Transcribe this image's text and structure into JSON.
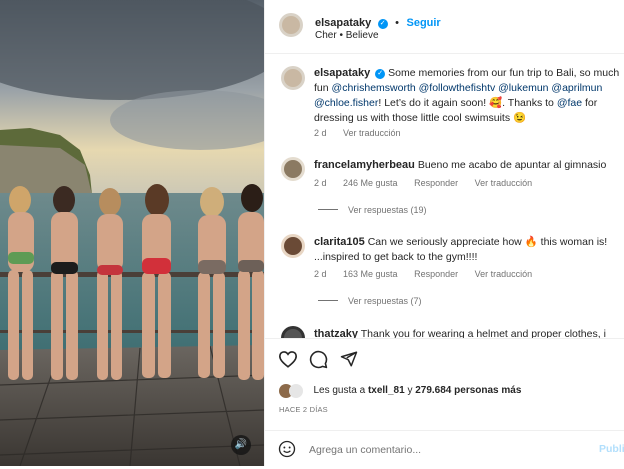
{
  "header": {
    "username": "elsapataky",
    "follow_label": "Seguir",
    "audio": "Cher • Believe"
  },
  "caption": {
    "username": "elsapataky",
    "text_1": "Some memories from our fun trip to Bali, so much fun",
    "mentions_1": "@chrishemsworth @followthefishtv @lukemun @aprilmun",
    "mention_2": "@chloe.fisher",
    "text_2": "! Let’s do it again soon! 🥰. Thanks to",
    "mention_3": "@fae",
    "text_3": "for dressing us with those little cool swimsuits 😉",
    "time": "2 d",
    "translate": "Ver traducción"
  },
  "comments": [
    {
      "username": "francelamyherbeau",
      "text": "Bueno me acabo de apuntar al gimnasio",
      "time": "2 d",
      "likes": "246 Me gusta",
      "reply": "Responder",
      "translate": "Ver traducción",
      "replies": "Ver respuestas (19)"
    },
    {
      "username": "clarita105",
      "text_1": "Can we seriously appreciate how 🔥 this woman is!",
      "text_2": "...inspired to get back to the gym!!!!",
      "time": "2 d",
      "likes": "163 Me gusta",
      "reply": "Responder",
      "translate": "Ver traducción",
      "replies": "Ver respuestas (7)"
    },
    {
      "username": "thatzaky",
      "text": "Thank you for wearing a helmet and proper clothes, i"
    }
  ],
  "likes": {
    "prefix": "Les gusta a",
    "user": "txell_81",
    "middle": "y",
    "count": "279.684 personas más"
  },
  "date": "HACE 2 DÍAS",
  "add_comment": {
    "placeholder": "Agrega un comentario...",
    "post_label": "Publicar"
  },
  "colors": {
    "accent": "#0095f6",
    "muted": "#737373"
  },
  "icons": [
    "heart-icon",
    "comment-icon",
    "share-icon",
    "emoji-icon",
    "sound-icon",
    "verified-icon"
  ]
}
